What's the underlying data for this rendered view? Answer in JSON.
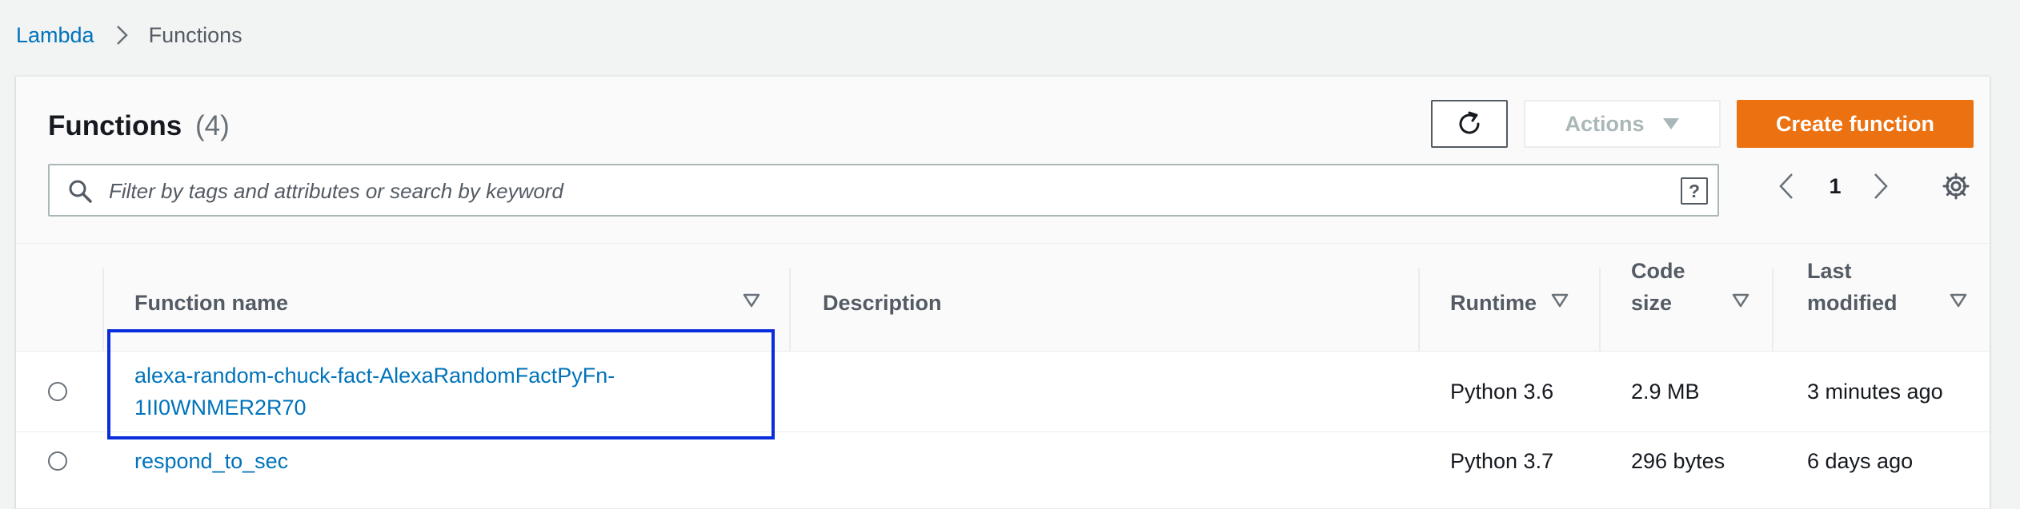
{
  "breadcrumb": {
    "root": "Lambda",
    "current": "Functions"
  },
  "panel": {
    "title": "Functions",
    "count": "(4)"
  },
  "toolbar": {
    "refresh_icon": "refresh-icon",
    "actions_label": "Actions",
    "create_label": "Create function"
  },
  "search": {
    "placeholder": "Filter by tags and attributes or search by keyword",
    "value": "",
    "help_label": "?"
  },
  "pagination": {
    "current_page": "1"
  },
  "table": {
    "columns": [
      {
        "label": "Function name",
        "sortable": true
      },
      {
        "label": "Description",
        "sortable": false
      },
      {
        "label": "Runtime",
        "sortable": true
      },
      {
        "label_line1": "Code",
        "label_line2": "size",
        "sortable": true
      },
      {
        "label_line1": "Last",
        "label_line2": "modified",
        "sortable": true
      }
    ],
    "rows": [
      {
        "name_line1": "alexa-random-chuck-fact-AlexaRandomFactPyFn-",
        "name_line2": "1II0WNMER2R70",
        "description": "",
        "runtime": "Python 3.6",
        "code_size": "2.9 MB",
        "last_modified": "3 minutes ago",
        "selected": false,
        "highlighted": true
      },
      {
        "name": "respond_to_sec",
        "description": "",
        "runtime": "Python 3.7",
        "code_size": "296 bytes",
        "last_modified": "6 days ago",
        "selected": false,
        "highlighted": false
      }
    ]
  },
  "colors": {
    "link": "#0073bb",
    "primary_button": "#ec7211",
    "highlight_border": "#0a2ddc",
    "page_background": "#f2f3f3"
  }
}
